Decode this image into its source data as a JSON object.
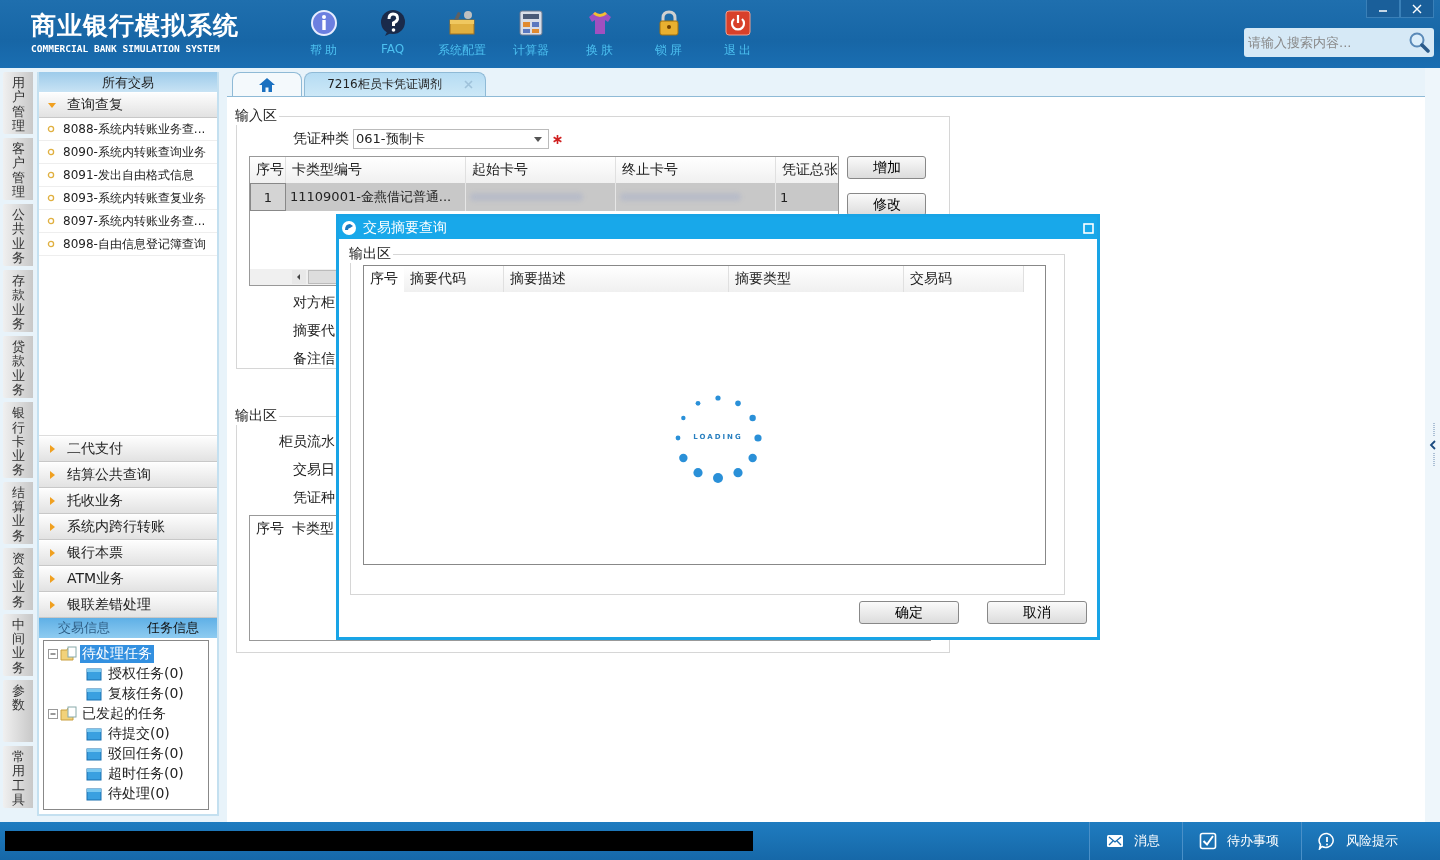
{
  "header": {
    "title": "商业银行模拟系统",
    "subtitle": "COMMERCIAL BANK SIMULATION SYSTEM"
  },
  "tools": [
    {
      "kind": "info",
      "label": "帮 助"
    },
    {
      "kind": "help",
      "label": "FAQ"
    },
    {
      "kind": "toolbox",
      "label": "系统配置"
    },
    {
      "kind": "calculator",
      "label": "计算器"
    },
    {
      "kind": "shirt",
      "label": "换 肤"
    },
    {
      "kind": "lock",
      "label": "锁 屏"
    },
    {
      "kind": "power",
      "label": "退 出"
    }
  ],
  "search": {
    "placeholder": "请输入搜索内容..."
  },
  "side_tabs": [
    "用户管理",
    "客户管理",
    "公共业务",
    "存款业务",
    "贷款业务",
    "银行卡业务",
    "结算业务",
    "资金业务",
    "中间业务",
    "参数",
    "常用工具"
  ],
  "nav": {
    "title": "所有交易",
    "groups": [
      {
        "label": "查询查复",
        "expanded": true,
        "items": [
          "8088-系统内转账业务查...",
          "8090-系统内转账查询业务",
          "8091-发出自由格式信息",
          "8093-系统内转账查复业务",
          "8097-系统内转账业务查...",
          "8098-自由信息登记簿查询"
        ]
      },
      {
        "label": "二代支付",
        "expanded": false
      },
      {
        "label": "结算公共查询",
        "expanded": false
      },
      {
        "label": "托收业务",
        "expanded": false
      },
      {
        "label": "系统内跨行转账",
        "expanded": false
      },
      {
        "label": "银行本票",
        "expanded": false
      },
      {
        "label": "ATM业务",
        "expanded": false
      },
      {
        "label": "银联差错处理",
        "expanded": false
      }
    ]
  },
  "info_tabs": [
    {
      "label": "交易信息",
      "selected": false
    },
    {
      "label": "任务信息",
      "selected": true
    }
  ],
  "task_tree": [
    {
      "label": "待处理任务",
      "selected": true,
      "expanded": true,
      "children": [
        {
          "label": "授权任务(0)",
          "selected": false
        },
        {
          "label": "复核任务(0)",
          "selected": false
        }
      ]
    },
    {
      "label": "已发起的任务",
      "selected": false,
      "expanded": true,
      "children": [
        {
          "label": "待提交(0)",
          "selected": false
        },
        {
          "label": "驳回任务(0)",
          "selected": false
        },
        {
          "label": "超时任务(0)",
          "selected": false
        },
        {
          "label": "待处理(0)",
          "selected": false
        }
      ]
    }
  ],
  "page_tabs": [
    {
      "kind": "home",
      "selected": false
    },
    {
      "kind": "text",
      "label": "7216柜员卡凭证调剂",
      "selected": true
    }
  ],
  "input_area": {
    "legend": "输入区",
    "voucher_label": "凭证种类",
    "voucher_value": "061-预制卡",
    "required": true,
    "columns": [
      "序号",
      "卡类型编号",
      "起始卡号",
      "终止卡号",
      "凭证总张"
    ],
    "rows": [
      {
        "selected": true,
        "cells": [
          {
            "kind": "text",
            "text": "1"
          },
          {
            "kind": "text",
            "text": "11109001-金燕借记普通..."
          },
          {
            "kind": "blurred"
          },
          {
            "kind": "blurred"
          },
          {
            "kind": "text",
            "text": "1"
          }
        ]
      }
    ],
    "buttons": [
      "增加",
      "修改"
    ],
    "labels": [
      "对方柜",
      "摘要代",
      "备注信"
    ]
  },
  "output_area": {
    "legend": "输出区",
    "labels": [
      "柜员流水",
      "交易日",
      "凭证种"
    ],
    "columns": [
      "序号",
      "卡类型"
    ]
  },
  "dialog": {
    "title": "交易摘要查询",
    "legend": "输出区",
    "columns": [
      "序号",
      "摘要代码",
      "摘要描述",
      "摘要类型",
      "交易码"
    ],
    "loading": "LOADING",
    "buttons": [
      "确定",
      "取消"
    ]
  },
  "status_bar": [
    {
      "kind": "mail",
      "label": "消息"
    },
    {
      "kind": "check",
      "label": "待办事项"
    },
    {
      "kind": "chat",
      "label": "风险提示"
    }
  ]
}
